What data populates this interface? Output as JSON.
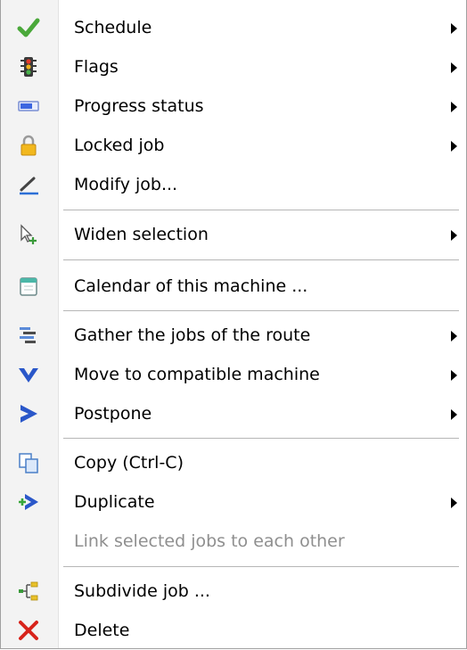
{
  "menu": {
    "items": [
      {
        "label": "Schedule",
        "icon": "checkmark-icon"
      },
      {
        "label": "Flags",
        "icon": "traffic-light-icon"
      },
      {
        "label": "Progress status",
        "icon": "progress-bar-icon"
      },
      {
        "label": "Locked job",
        "icon": "padlock-icon"
      },
      {
        "label": "Modify job...",
        "icon": "pen-edit-icon"
      },
      {
        "label": "Widen selection",
        "icon": "cursor-plus-icon"
      },
      {
        "label": "Calendar of this machine ...",
        "icon": "calendar-icon"
      },
      {
        "label": "Gather the jobs of the route",
        "icon": "gather-bars-icon"
      },
      {
        "label": "Move to compatible machine",
        "icon": "chevron-down-icon"
      },
      {
        "label": "Postpone",
        "icon": "chevron-right-icon"
      },
      {
        "label": "Copy (Ctrl-C)",
        "icon": "copy-pages-icon"
      },
      {
        "label": "Duplicate",
        "icon": "duplicate-arrow-icon"
      },
      {
        "label": "Link selected jobs to each other",
        "icon": "",
        "disabled": true
      },
      {
        "label": "Subdivide job ...",
        "icon": "subdivide-icon"
      },
      {
        "label": "Delete",
        "icon": "red-x-icon"
      }
    ]
  }
}
